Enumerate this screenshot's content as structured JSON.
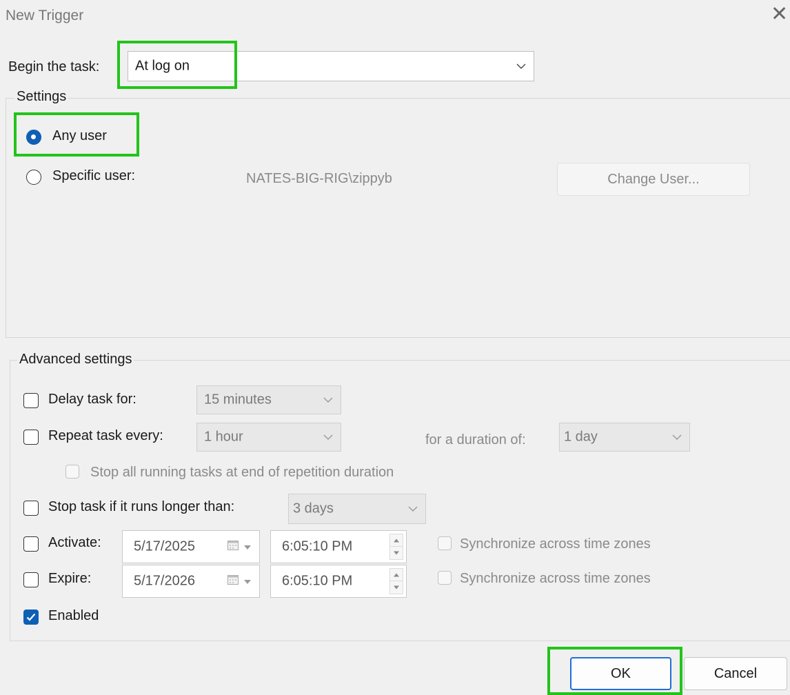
{
  "window": {
    "title": "New Trigger",
    "close_glyph": "✕"
  },
  "begin": {
    "label": "Begin the task:",
    "value": "At log on"
  },
  "settings": {
    "title": "Settings",
    "any_user_label": "Any user",
    "any_user_selected": true,
    "specific_user_label": "Specific user:",
    "specific_user_value": "NATES-BIG-RIG\\zippyb",
    "change_user_label": "Change User..."
  },
  "advanced": {
    "title": "Advanced settings",
    "delay": {
      "label": "Delay task for:",
      "value": "15 minutes",
      "checked": false
    },
    "repeat": {
      "label": "Repeat task every:",
      "value": "1 hour",
      "checked": false,
      "duration_label": "for a duration of:",
      "duration_value": "1 day"
    },
    "stop_all": {
      "label": "Stop all running tasks at end of repetition duration",
      "checked": false
    },
    "stop_longer": {
      "label": "Stop task if it runs longer than:",
      "value": "3 days",
      "checked": false
    },
    "activate": {
      "label": "Activate:",
      "date": "5/17/2025",
      "time": "6:05:10 PM",
      "sync_label": "Synchronize across time zones",
      "checked": false
    },
    "expire": {
      "label": "Expire:",
      "date": "5/17/2026",
      "time": "6:05:10 PM",
      "sync_label": "Synchronize across time zones",
      "checked": false
    },
    "enabled": {
      "label": "Enabled",
      "checked": true
    }
  },
  "footer": {
    "ok_label": "OK",
    "cancel_label": "Cancel"
  },
  "colors": {
    "accent": "#0f5fb5",
    "highlight": "#22c41a",
    "background": "#f0f0f0"
  }
}
